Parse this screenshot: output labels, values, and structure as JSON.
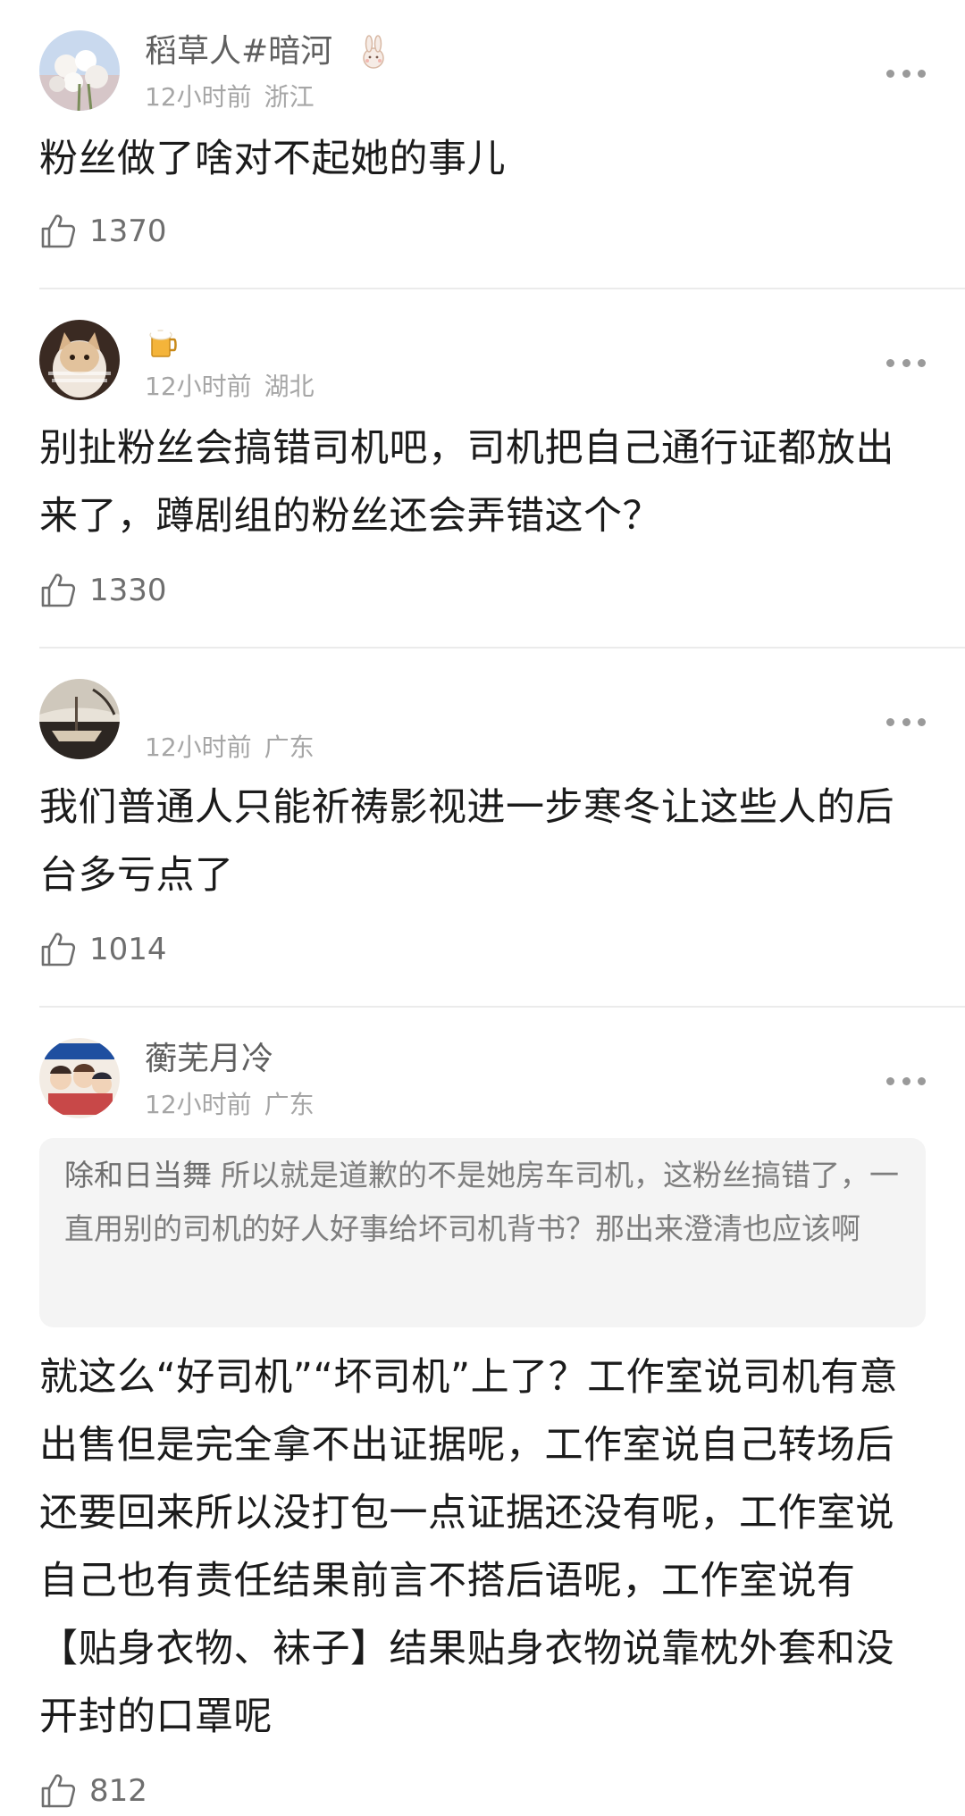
{
  "comments": [
    {
      "username": "稻草人#暗河",
      "badge_icon": "rabbit-icon",
      "time": "12小时前",
      "location": "浙江",
      "text": "粉丝做了啥对不起她的事儿",
      "likes": "1370"
    },
    {
      "username": "",
      "badge_icon": "beer-icon",
      "time": "12小时前",
      "location": "湖北",
      "text": "别扯粉丝会搞错司机吧，司机把自己通行证都放出来了，蹲剧组的粉丝还会弄错这个？",
      "likes": "1330"
    },
    {
      "username": "",
      "time": "12小时前",
      "location": "广东",
      "text": "我们普通人只能祈祷影视进一步寒冬让这些人的后台多亏点了",
      "likes": "1014"
    },
    {
      "username": "蘅芜月冷",
      "time": "12小时前",
      "location": "广东",
      "quote_author": "除和日当舞",
      "quote_text": "所以就是道歉的不是她房车司机，这粉丝搞错了，一直用别的司机的好人好事给坏司机背书？那出来澄清也应该啊",
      "text": "就这么“好司机”“坏司机”上了？工作室说司机有意出售但是完全拿不出证据呢，工作室说自己转场后还要回来所以没打包一点证据还没有呢，工作室说自己也有责任结果前言不搭后语呢，工作室说有【贴身衣物、袜子】结果贴身衣物说靠枕外套和没开封的口罩呢",
      "likes": "812"
    }
  ],
  "colors": {
    "text": "#1b1b1b",
    "username": "#5f5f5f",
    "meta": "#a6a6a6",
    "quote_bg": "#f4f4f4",
    "divider": "#ebebeb"
  }
}
